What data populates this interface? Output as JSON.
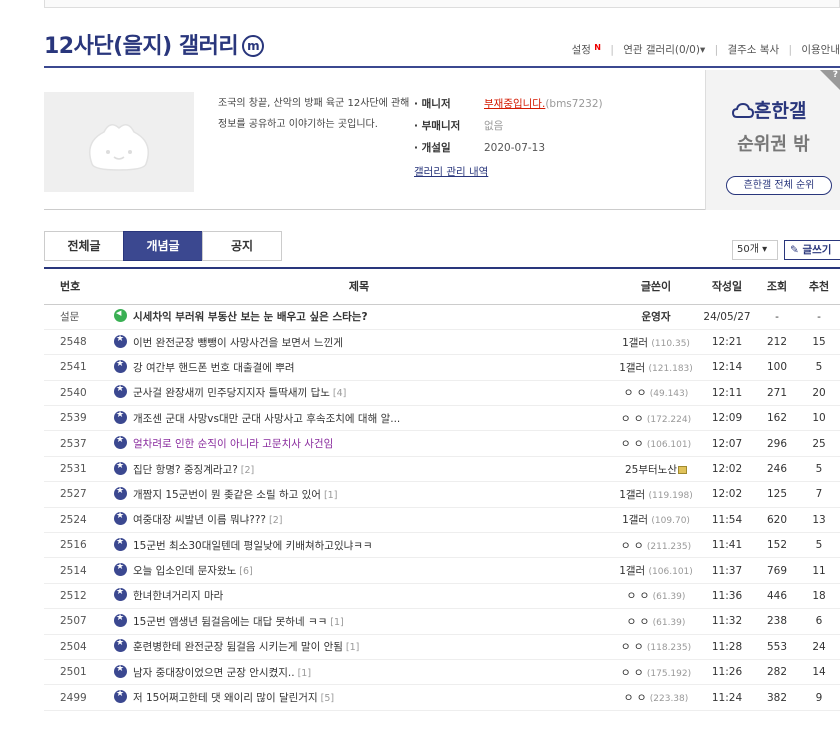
{
  "header": {
    "title": "12사단(을지) 갤러리",
    "badge": "m",
    "links": {
      "settings": "설정",
      "settings_badge": "N",
      "related": "연관 갤러리(0/0)",
      "related_arrow": "▾",
      "copy": "결주소 복사",
      "guide": "이용안내"
    }
  },
  "info": {
    "description": "조국의 창끝, 산악의 방패 육군 12사단에 관해 정보를 공유하고 이야기하는 곳입니다.",
    "manager_label": "· 매니저",
    "manager_value": "부재중입니다.",
    "manager_id": "(bms7232)",
    "submanager_label": "· 부매니저",
    "submanager_value": "없음",
    "opened_label": "· 개설일",
    "opened_value": "2020-07-13",
    "mgmt_link": "갤러리 관리 내역"
  },
  "rank": {
    "corner_label": "?",
    "logo": "흔한갤",
    "status": "순위권 밖",
    "button": "흔한갤 전체 순위"
  },
  "tabs": [
    {
      "label": "전체글",
      "active": false
    },
    {
      "label": "개념글",
      "active": true
    },
    {
      "label": "공지",
      "active": false
    }
  ],
  "controls": {
    "pagesize": "50개 ▾",
    "write": "✎ 글쓰기"
  },
  "columns": {
    "num": "번호",
    "subject": "제목",
    "writer": "글쓴이",
    "date": "작성일",
    "views": "조회",
    "recommend": "추천"
  },
  "rows": [
    {
      "num": "설문",
      "subject": "시세차익 부러워 부동산 보는 눈 배우고 싶은 스타는?",
      "comments": "",
      "writer": "운영자",
      "ip": "",
      "date": "24/05/27",
      "views": "-",
      "rec": "-",
      "style": "notice"
    },
    {
      "num": "2548",
      "subject": "이번 완전군장 뺑뺑이 사망사건을 보면서 느낀게",
      "comments": "",
      "writer": "1갤러",
      "ip": "(110.35)",
      "date": "12:21",
      "views": "212",
      "rec": "15",
      "style": ""
    },
    {
      "num": "2541",
      "subject": "강 여간부 핸드폰 번호 대출결에 뿌려",
      "comments": "",
      "writer": "1갤러",
      "ip": "(121.183)",
      "date": "12:14",
      "views": "100",
      "rec": "5",
      "style": ""
    },
    {
      "num": "2540",
      "subject": "군사걸 완장새끼 민주당지지자 틀딱새끼 답노",
      "comments": "[4]",
      "writer": "ㅇ ㅇ",
      "ip": "(49.143)",
      "date": "12:11",
      "views": "271",
      "rec": "20",
      "style": ""
    },
    {
      "num": "2539",
      "subject": "개조센 군대 사망vs대만 군대 사망사고 후속조치에 대해 알...",
      "comments": "",
      "writer": "ㅇ ㅇ",
      "ip": "(172.224)",
      "date": "12:09",
      "views": "162",
      "rec": "10",
      "style": ""
    },
    {
      "num": "2537",
      "subject": "얼차려로 인한 순직이 아니라 고문치사 사건임",
      "comments": "",
      "writer": "ㅇ ㅇ",
      "ip": "(106.101)",
      "date": "12:07",
      "views": "296",
      "rec": "25",
      "style": "purple"
    },
    {
      "num": "2531",
      "subject": "집단 항명? 중징계라고?",
      "comments": "[2]",
      "writer": "25부터노산",
      "ip": "",
      "date": "12:02",
      "views": "246",
      "rec": "5",
      "style": "locked"
    },
    {
      "num": "2527",
      "subject": "개짬지 15군번이 뭔 좆같은 소릴 하고 있어",
      "comments": "[1]",
      "writer": "1갤러",
      "ip": "(119.198)",
      "date": "12:02",
      "views": "125",
      "rec": "7",
      "style": ""
    },
    {
      "num": "2524",
      "subject": "여중대장 씨발년 이름 뭐냐???",
      "comments": "[2]",
      "writer": "1갤러",
      "ip": "(109.70)",
      "date": "11:54",
      "views": "620",
      "rec": "13",
      "style": ""
    },
    {
      "num": "2516",
      "subject": "15군번 최소30대일텐데 평일낮에 키배쳐하고있냐ㅋㅋ",
      "comments": "",
      "writer": "ㅇ ㅇ",
      "ip": "(211.235)",
      "date": "11:41",
      "views": "152",
      "rec": "5",
      "style": ""
    },
    {
      "num": "2514",
      "subject": "오늘 입소인데 문자왔노",
      "comments": "[6]",
      "writer": "1갤러",
      "ip": "(106.101)",
      "date": "11:37",
      "views": "769",
      "rec": "11",
      "style": ""
    },
    {
      "num": "2512",
      "subject": "한녀한녀거리지 마라",
      "comments": "",
      "writer": "ㅇ ㅇ",
      "ip": "(61.39)",
      "date": "11:36",
      "views": "446",
      "rec": "18",
      "style": ""
    },
    {
      "num": "2507",
      "subject": "15군번 앰생년 뒴걸음에는 대답 못하네 ㅋㅋ",
      "comments": "[1]",
      "writer": "ㅇ ㅇ",
      "ip": "(61.39)",
      "date": "11:32",
      "views": "238",
      "rec": "6",
      "style": ""
    },
    {
      "num": "2504",
      "subject": "훈련병한테 완전군장 뒴걸음 시키는게 말이 안됨",
      "comments": "[1]",
      "writer": "ㅇ ㅇ",
      "ip": "(118.235)",
      "date": "11:28",
      "views": "553",
      "rec": "24",
      "style": ""
    },
    {
      "num": "2501",
      "subject": "남자 중대장이었으면 군장 안시켰지..",
      "comments": "[1]",
      "writer": "ㅇ ㅇ",
      "ip": "(175.192)",
      "date": "11:26",
      "views": "282",
      "rec": "14",
      "style": ""
    },
    {
      "num": "2499",
      "subject": "저 15어쩌고한테 댓 왜이리 많이 달린거지",
      "comments": "[5]",
      "writer": "ㅇ ㅇ",
      "ip": "(223.38)",
      "date": "11:24",
      "views": "382",
      "rec": "9",
      "style": ""
    }
  ]
}
